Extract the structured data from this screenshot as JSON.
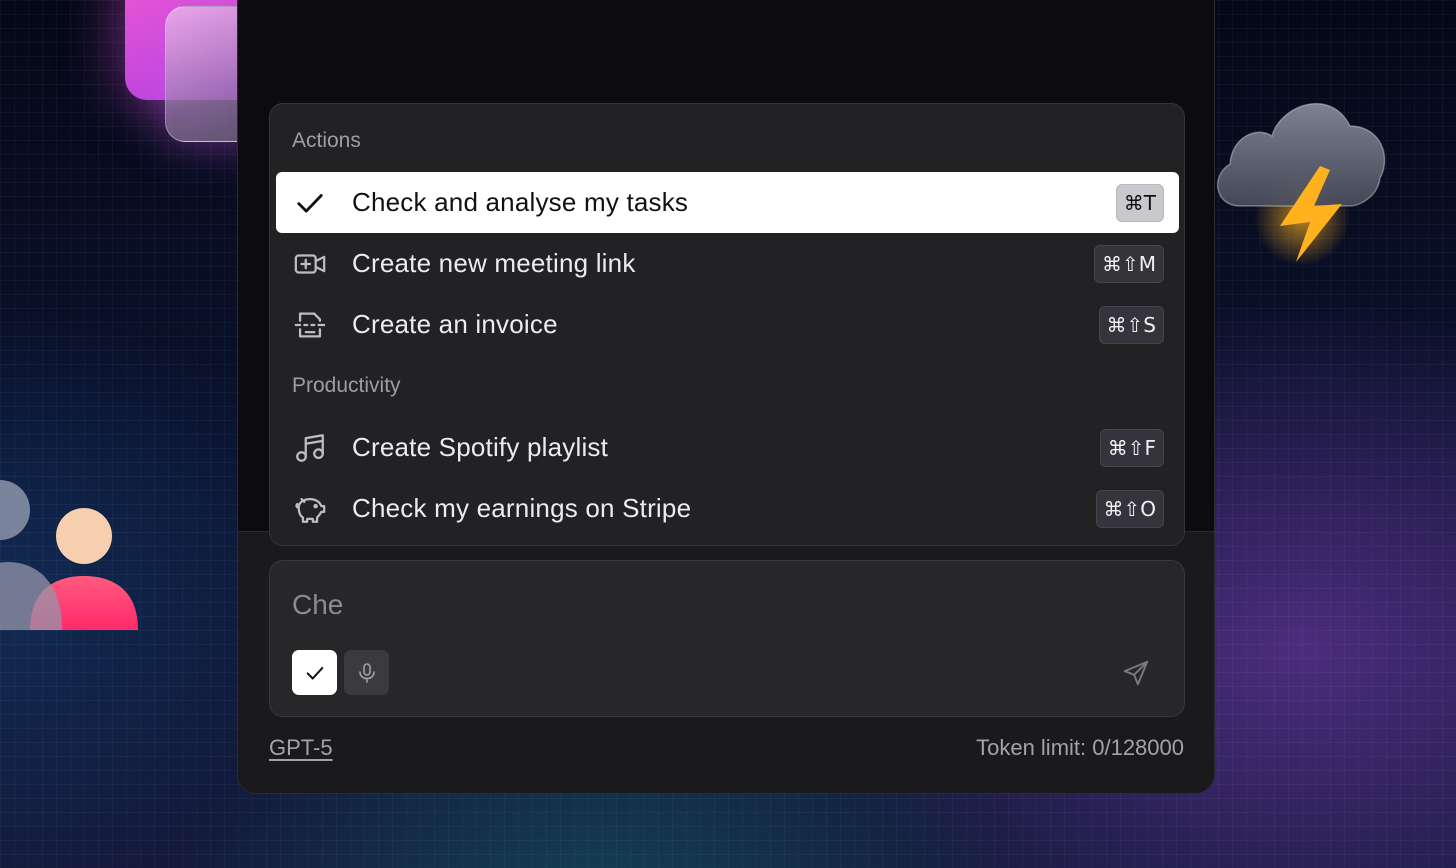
{
  "dropdown": {
    "sections": [
      {
        "label": "Actions",
        "items": [
          {
            "label": "Check and analyse my tasks",
            "shortcut": "⌘T",
            "icon": "check-icon",
            "selected": true
          },
          {
            "label": "Create new meeting link",
            "shortcut": "⌘⇧M",
            "icon": "video-plus-icon",
            "selected": false
          },
          {
            "label": "Create an invoice",
            "shortcut": "⌘⇧S",
            "icon": "invoice-icon",
            "selected": false
          }
        ]
      },
      {
        "label": "Productivity",
        "items": [
          {
            "label": "Create Spotify playlist",
            "shortcut": "⌘⇧F",
            "icon": "music-note-icon",
            "selected": false
          },
          {
            "label": "Check my earnings on Stripe",
            "shortcut": "⌘⇧O",
            "icon": "piggy-bank-icon",
            "selected": false
          }
        ]
      }
    ]
  },
  "composer": {
    "input_value": "Che",
    "tools": [
      {
        "icon": "check-icon",
        "active": true
      },
      {
        "icon": "microphone-icon",
        "active": false
      }
    ],
    "send_icon": "send-icon"
  },
  "footer": {
    "model": "GPT-5",
    "token_limit": "Token limit: 0/128000"
  },
  "colors": {
    "panel_bg": "#0c0c0e",
    "dropdown_bg": "#222225",
    "selected_bg": "#ffffff",
    "accent_pink": "#f25ad3",
    "bolt_yellow": "#ffb21e"
  }
}
